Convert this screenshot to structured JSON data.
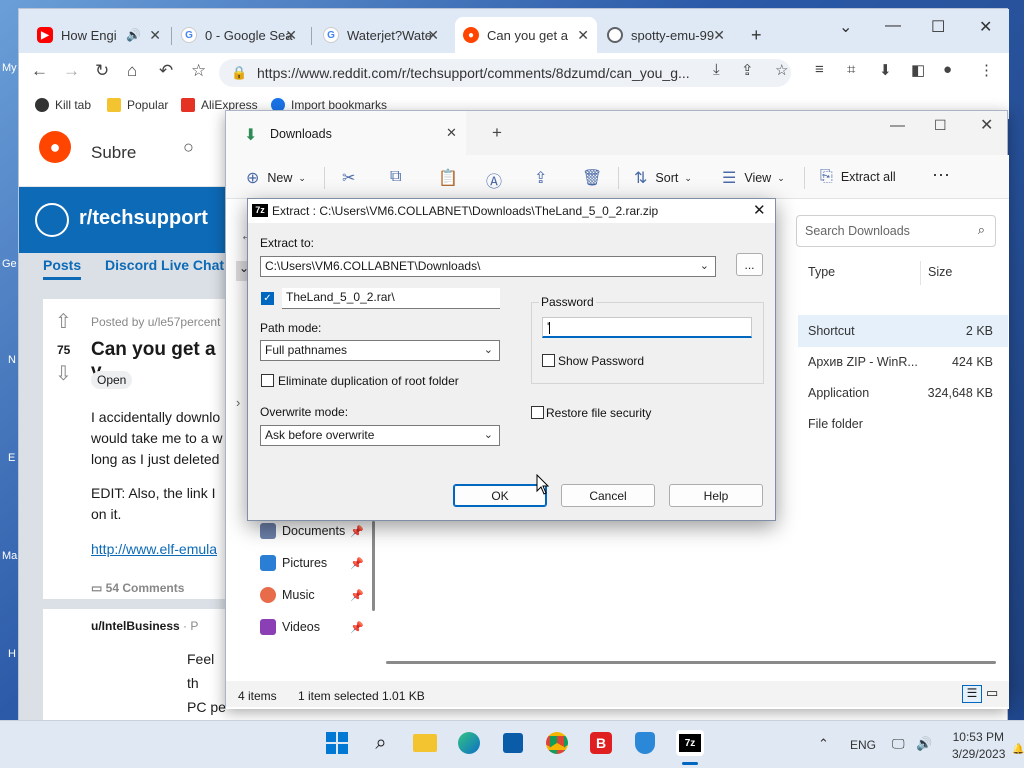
{
  "chrome": {
    "tabs": [
      {
        "label": "How Engi",
        "icon_color": "#ff0000",
        "extra": "🔊"
      },
      {
        "label": "0 - Google Sea",
        "icon_color": "#4285f4"
      },
      {
        "label": "Waterjet?Wate",
        "icon_color": "#4285f4"
      },
      {
        "label": "Can you get a",
        "icon_color": "#ff4500"
      },
      {
        "label": "spotty-emu-99",
        "icon_color": "#5f6368"
      }
    ],
    "new_tab": "+",
    "url": "https://www.reddit.com/r/techsupport/comments/8dzumd/can_you_g...",
    "bookmarks": [
      "Kill tab",
      "Popular",
      "AliExpress",
      "Import bookmarks"
    ]
  },
  "reddit": {
    "logo_partial": "Subre",
    "subreddit": "r/techsupport",
    "nav": [
      "Posts",
      "Discord Live Chat"
    ],
    "posted_by": "Posted by u/le57percent",
    "votes": "75",
    "post_title": "Can you get a v",
    "flair": "Open",
    "body_lines": [
      "I accidentally downlo",
      "would take me to a w",
      "long as I just deleted"
    ],
    "edit_lines": [
      "EDIT: Also, the link I",
      "on it."
    ],
    "link": "http://www.elf-emula",
    "comments": "54 Comments",
    "commenter": "u/IntelBusiness",
    "commenter_suffix": "· P",
    "comment_lines": [
      "Feel th",
      "PC pe"
    ]
  },
  "explorer": {
    "tab_title": "Downloads",
    "ribbon": {
      "new": "New",
      "sort": "Sort",
      "view": "View",
      "extract_all": "Extract all",
      "more": "···"
    },
    "search_placeholder": "Search Downloads",
    "columns": {
      "type": "Type",
      "size": "Size"
    },
    "rows": [
      {
        "type": "Shortcut",
        "size": "2 KB"
      },
      {
        "type": "Архив ZIP - WinR...",
        "size": "424 KB"
      },
      {
        "type": "Application",
        "size": "324,648 KB"
      },
      {
        "type": "File folder",
        "size": ""
      }
    ],
    "nav_items": [
      "Documents",
      "Pictures",
      "Music",
      "Videos"
    ],
    "status": {
      "items": "4 items",
      "selected": "1 item selected  1.01 KB"
    }
  },
  "dialog": {
    "title": "Extract : C:\\Users\\VM6.COLLABNET\\Downloads\\TheLand_5_0_2.rar.zip",
    "extract_to_label": "Extract to:",
    "extract_to_value": "C:\\Users\\VM6.COLLABNET\\Downloads\\",
    "browse": "...",
    "folder_name": "TheLand_5_0_2.rar\\",
    "path_mode_label": "Path mode:",
    "path_mode_value": "Full pathnames",
    "eliminate_dup": "Eliminate duplication of root folder",
    "overwrite_label": "Overwrite mode:",
    "overwrite_value": "Ask before overwrite",
    "password_label": "Password",
    "password_value": "'",
    "show_password": "Show Password",
    "restore_security": "Restore file security",
    "ok": "OK",
    "cancel": "Cancel",
    "help": "Help"
  },
  "taskbar": {
    "lang": "ENG",
    "time": "10:53 PM",
    "date": "3/29/2023"
  },
  "desktop_labels": [
    "My",
    "Ge",
    "N",
    "E",
    "Ma",
    "H"
  ]
}
